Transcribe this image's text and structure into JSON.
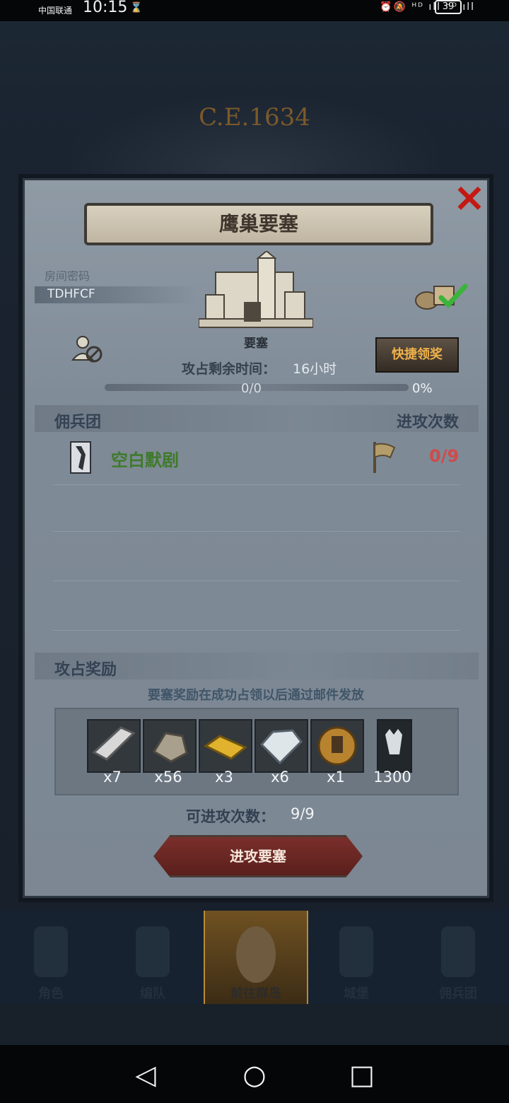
{
  "status_bar": {
    "carrier": "中国联通",
    "time": "10:15",
    "indicators": "⏰🔕 ᴴᴰ ıll ᴴᴰ ıll",
    "battery": "39"
  },
  "background": {
    "era": "C.E.1634"
  },
  "dialog": {
    "title": "鹰巢要塞",
    "room_code_label": "房间密码",
    "room_code": "TDHFCF",
    "fortress_label": "要塞",
    "quick_claim": "快捷领奖",
    "timer_label": "攻占剩余时间：",
    "timer_value": "16小时",
    "progress_text": "0/0",
    "progress_percent": "0%",
    "progress_fraction": 0,
    "merc_section": "佣兵团",
    "attack_times_header": "进攻次数",
    "merc_name": "空白默剧",
    "merc_attack_count": "0/9",
    "reward_section": "攻占奖励",
    "reward_note": "要塞奖励在成功占领以后通过邮件发放",
    "rewards": [
      {
        "count": "x7"
      },
      {
        "count": "x56"
      },
      {
        "count": "x3"
      },
      {
        "count": "x6"
      },
      {
        "count": "x1"
      },
      {
        "count": "1300"
      }
    ],
    "attack_label": "可进攻次数：",
    "attack_value": "9/9",
    "attack_button": "进攻要塞"
  },
  "bottom_nav": [
    {
      "label": "角色"
    },
    {
      "label": "编队"
    },
    {
      "label": "前往群岛"
    },
    {
      "label": "城堡"
    },
    {
      "label": "佣兵团"
    }
  ],
  "icons": {
    "close": "close-icon",
    "back": "back-triangle-icon",
    "home": "home-circle-icon",
    "recent": "recent-square-icon"
  }
}
